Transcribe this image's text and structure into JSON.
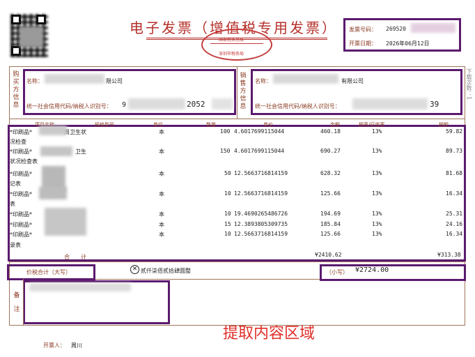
{
  "invoice": {
    "title": "电子发票（增值税专用发票）",
    "number_label": "发票号码：",
    "number_value": "269520",
    "date_label": "开票日期：",
    "date_value": "2026年06月12日"
  },
  "seal": {
    "top_text": "国家税务总局",
    "bottom_text": "深圳市税务局"
  },
  "side_text": "下载次数：1",
  "buyer": {
    "section_label": "购买方信息",
    "name_label": "名称：",
    "name_value": "限公司",
    "tax_label": "统一社会信用代码/纳税人识别号：",
    "tax_value_prefix": "9",
    "tax_value_suffix": "2052"
  },
  "seller": {
    "section_label": "销售方信息",
    "name_label": "名称：",
    "name_value": "有限公司",
    "tax_label": "统一社会信用代码/纳税人识别号：",
    "tax_value_suffix": "39"
  },
  "table": {
    "headers": [
      "项目名称",
      "规格型号",
      "单位",
      "数量",
      "单价",
      "金额",
      "税率/征收率",
      "税额"
    ],
    "rows": [
      {
        "name": "*印刷品*",
        "name_suffix": "周卫生状",
        "name2": "况检查",
        "unit": "本",
        "qty": "100",
        "price": "4.6017699115044",
        "amount": "460.18",
        "rate": "13%",
        "tax": "59.82"
      },
      {
        "name": "*印刷品*",
        "name_suffix": "卫生",
        "name2": "状况检查表",
        "unit": "本",
        "qty": "150",
        "price": "4.6017699115044",
        "amount": "690.27",
        "rate": "13%",
        "tax": "89.73"
      },
      {
        "name": "*印刷品*",
        "name_suffix": "",
        "name2": "记表",
        "unit": "本",
        "qty": "50",
        "price": "12.5663716814159",
        "amount": "628.32",
        "rate": "13%",
        "tax": "81.68"
      },
      {
        "name": "*印刷品*",
        "name_suffix": "",
        "name2": "表",
        "unit": "本",
        "qty": "10",
        "price": "12.5663716814159",
        "amount": "125.66",
        "rate": "13%",
        "tax": "16.34"
      },
      {
        "name": "*印刷品*",
        "name_suffix": "",
        "name2": "",
        "unit": "本",
        "qty": "10",
        "price": "19.4690265486726",
        "amount": "194.69",
        "rate": "13%",
        "tax": "25.31"
      },
      {
        "name": "*印刷品*",
        "name_suffix": "",
        "name2": "",
        "unit": "本",
        "qty": "15",
        "price": "12.3893805309735",
        "amount": "185.84",
        "rate": "13%",
        "tax": "24.16"
      },
      {
        "name": "*印刷品*",
        "name_suffix": "",
        "name2": "录表",
        "unit": "本",
        "qty": "10",
        "price": "12.5663716814159",
        "amount": "125.66",
        "rate": "13%",
        "tax": "16.34"
      }
    ],
    "total_label": "合　　计",
    "total_amount": "¥2410.62",
    "total_tax": "¥313.38"
  },
  "summary": {
    "label": "价税合计（大写）",
    "uppercase_value": "贰仟柒佰贰拾肆圆整",
    "small_label": "（小写）",
    "small_value": "¥2724.00"
  },
  "remarks": {
    "label": "备注"
  },
  "overlay_caption": "提取内容区域",
  "issuer": {
    "label": "开票人：",
    "value": "周川"
  },
  "colors": {
    "frame": "#5b1a6e",
    "title": "#b4302a",
    "caption": "#e0302a",
    "label": "#8a3a22"
  }
}
